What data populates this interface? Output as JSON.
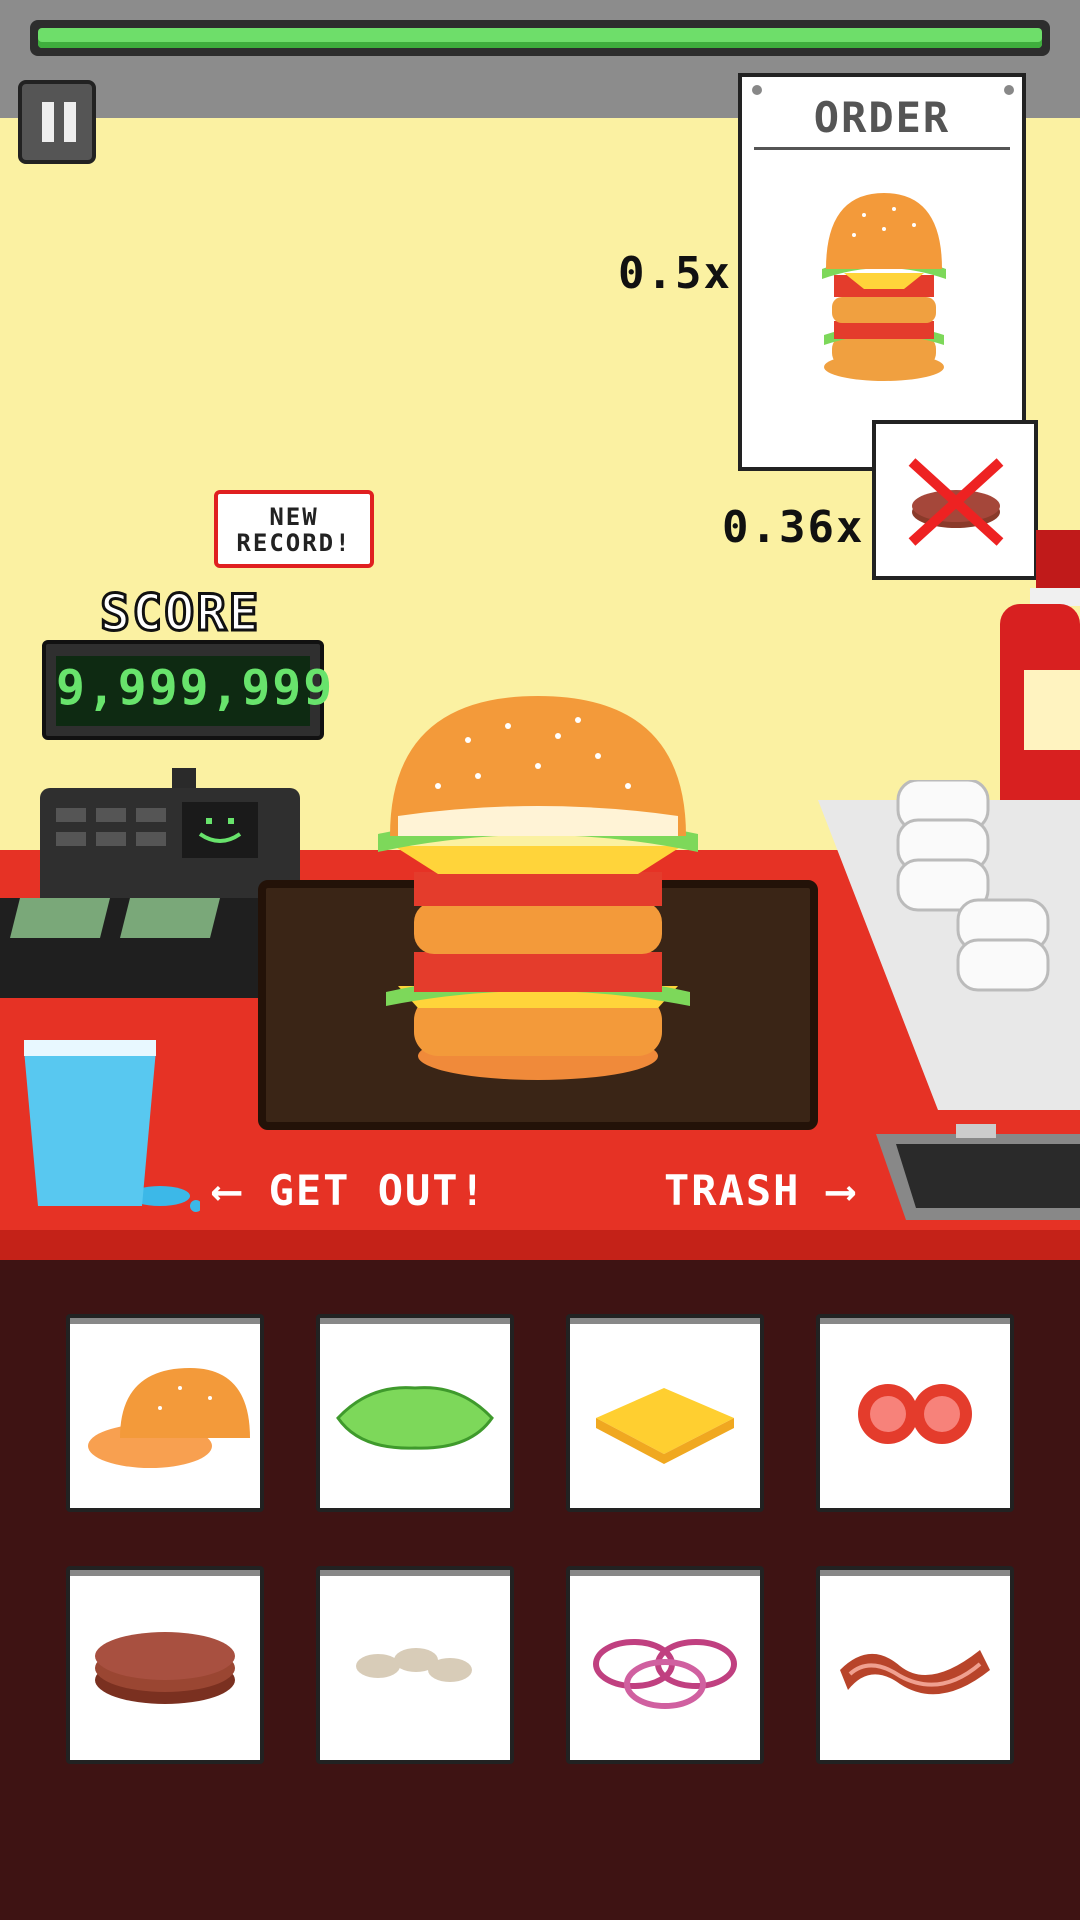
{
  "timer": {
    "remaining_fraction": 1.0
  },
  "order": {
    "title": "ORDER",
    "multiplier": "0.5x",
    "no_patty_multiplier": "0.36x",
    "no_patty_icon": "no-patty-icon"
  },
  "score": {
    "badge_line1": "NEW",
    "badge_line2": "RECORD!",
    "label": "SCORE",
    "value": "9,999,999"
  },
  "hints": {
    "get_out": "GET OUT!",
    "trash": "TRASH"
  },
  "ingredients": [
    {
      "icon": "bun-icon"
    },
    {
      "icon": "lettuce-icon"
    },
    {
      "icon": "cheese-icon"
    },
    {
      "icon": "tomato-icon"
    },
    {
      "icon": "patty-icon"
    },
    {
      "icon": "mushroom-icon"
    },
    {
      "icon": "onion-icon"
    },
    {
      "icon": "bacon-icon"
    }
  ],
  "colors": {
    "timer_green": "#6ede6a",
    "counter_red": "#e63225",
    "wall_yellow": "#fbf1a2",
    "score_green": "#68e36c"
  }
}
